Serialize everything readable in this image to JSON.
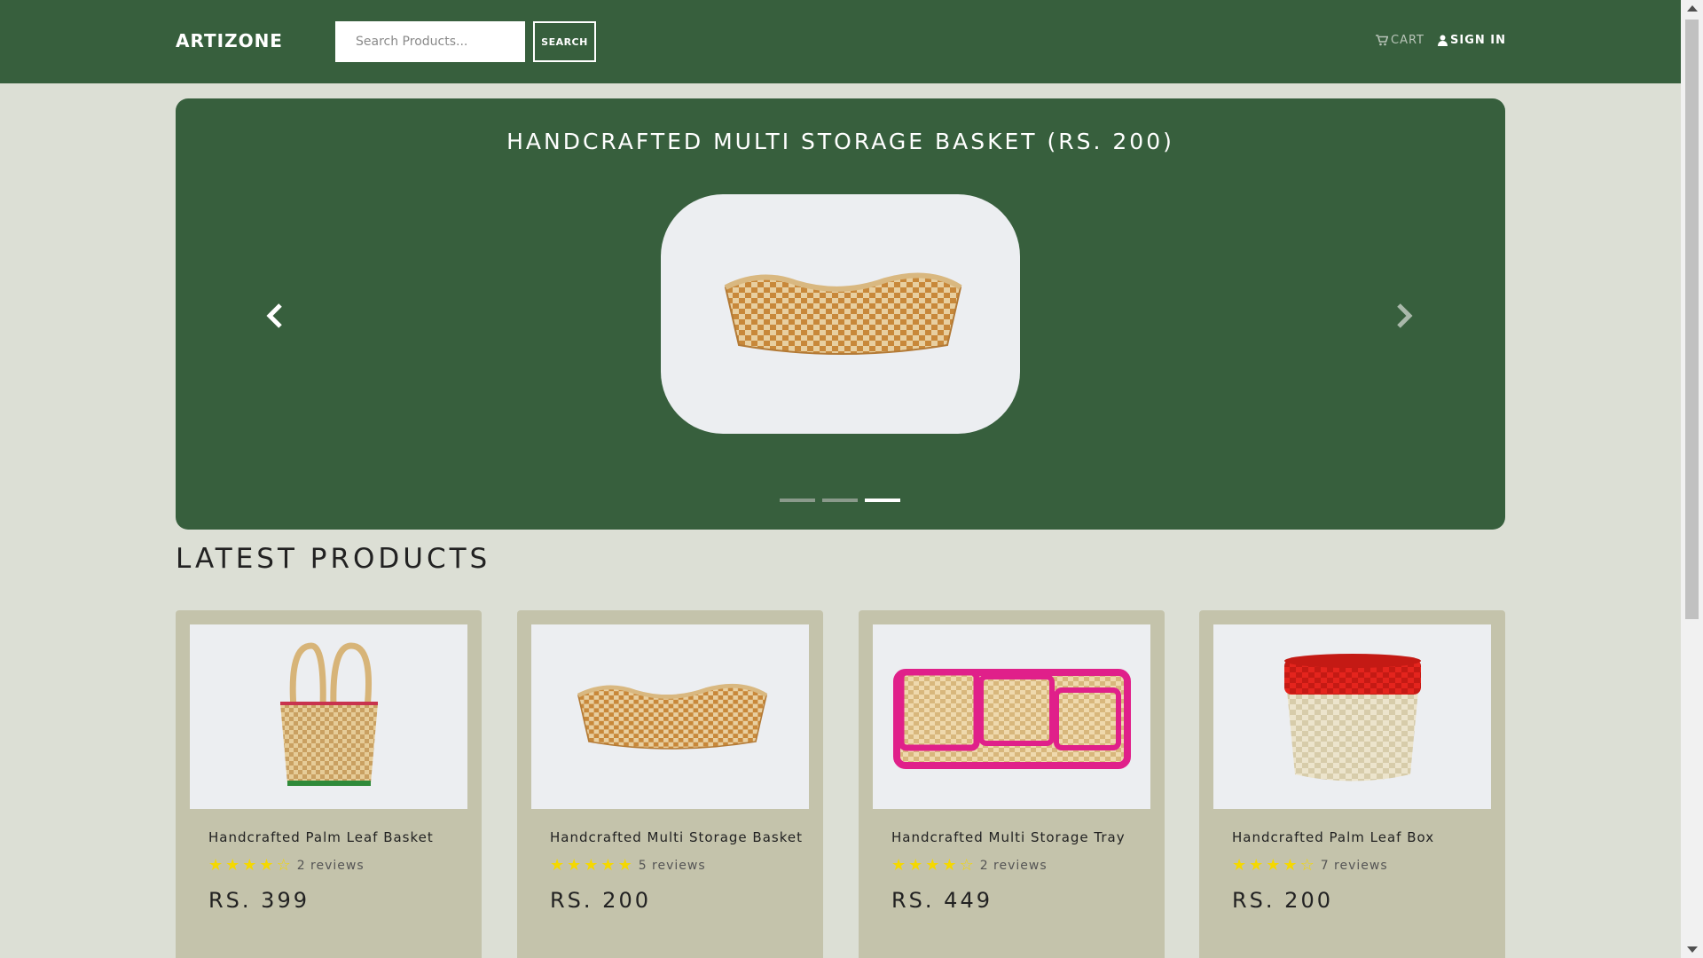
{
  "header": {
    "brand": "ARTIZONE",
    "search_placeholder": "Search Products...",
    "search_button": "SEARCH",
    "cart_label": "CART",
    "signin_label": "SIGN IN"
  },
  "carousel": {
    "title": "HANDCRAFTED MULTI STORAGE BASKET (RS. 200)",
    "indicator_count": 3,
    "active_index": 2
  },
  "latest": {
    "title": "LATEST PRODUCTS",
    "products": [
      {
        "name": "Handcrafted Palm Leaf Basket",
        "rating": 4,
        "reviews": "2 reviews",
        "price": "RS. 399"
      },
      {
        "name": "Handcrafted Multi Storage Basket",
        "rating": 5,
        "reviews": "5 reviews",
        "price": "RS. 200"
      },
      {
        "name": "Handcrafted Multi Storage Tray",
        "rating": 4,
        "reviews": "2 reviews",
        "price": "RS. 449"
      },
      {
        "name": "Handcrafted Palm Leaf Box",
        "rating": 4,
        "reviews": "7 reviews",
        "price": "RS. 200"
      }
    ]
  },
  "colors": {
    "primary_green": "#375f3d",
    "page_background": "#dcdfd5",
    "card_background": "#c4c3ab",
    "star": "#f5d800"
  }
}
